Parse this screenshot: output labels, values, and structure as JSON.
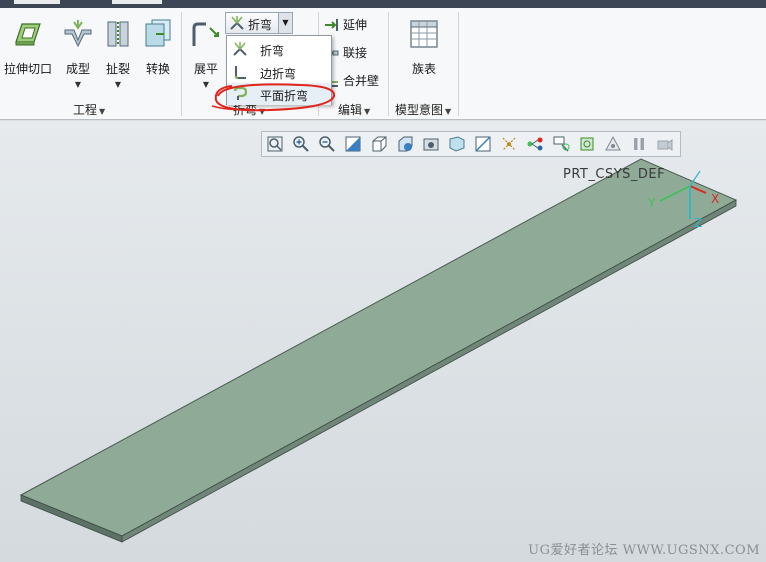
{
  "ribbon": {
    "groups": {
      "engineering": {
        "label": "工程",
        "buttons": {
          "extrude_cut": "拉伸切口",
          "form": "成型",
          "rip": "扯裂",
          "convert": "转换"
        }
      },
      "bend": {
        "label": "折弯",
        "buttons": {
          "unbend": "展平",
          "bend": "折弯"
        }
      },
      "edit": {
        "label": "编辑",
        "buttons": {
          "extend": "延伸",
          "join": "联接",
          "merge_walls": "合并壁"
        }
      },
      "model_intent": {
        "label": "模型意图",
        "buttons": {
          "family_table": "族表"
        }
      }
    },
    "bend_dropdown": {
      "items": [
        {
          "label": "折弯",
          "icon": "bend-icon"
        },
        {
          "label": "边折弯",
          "icon": "edge-bend-icon"
        },
        {
          "label": "平面折弯",
          "icon": "planar-bend-icon",
          "highlighted": true
        }
      ]
    }
  },
  "viewport": {
    "toolbar_icons": [
      "refit-icon",
      "zoom-in-icon",
      "zoom-out-icon",
      "repaint-icon",
      "display-style-icon",
      "saved-orientation-icon",
      "view-manager-icon",
      "perspective-icon",
      "section-icon",
      "datum-display-icon",
      "spin-center-icon",
      "annotation-display-icon",
      "appearance-icon",
      "simulation-icon",
      "pause-icon",
      "named-views-icon"
    ],
    "csys_label": "PRT_CSYS_DEF",
    "axes": {
      "x": "X",
      "y": "Y",
      "z": "Z"
    }
  },
  "watermark": "UG爱好者论坛 WWW.UGSNX.COM",
  "colors": {
    "plate_fill": "#8fab98",
    "plate_edge": "#4a5a50",
    "annotation_red": "#e0251b",
    "axis_red": "#e0251b",
    "axis_cyan": "#2ab8c8",
    "axis_green": "#3fbf5a"
  }
}
